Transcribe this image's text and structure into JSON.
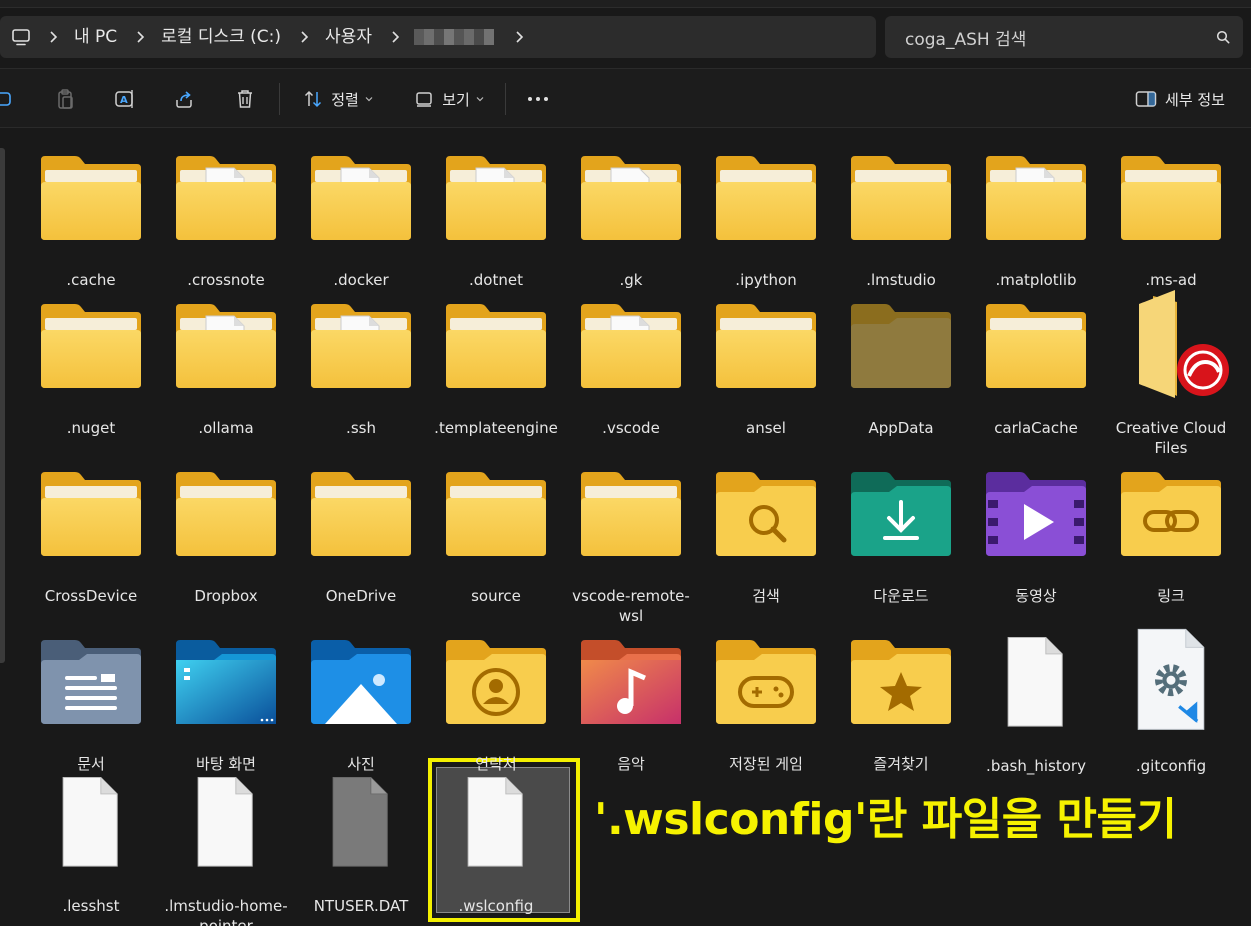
{
  "breadcrumb": {
    "items": [
      {
        "label": "내 PC"
      },
      {
        "label": "로컬 디스크 (C:)"
      },
      {
        "label": "사용자"
      }
    ]
  },
  "search": {
    "placeholder": "coga_ASH 검색"
  },
  "toolbar": {
    "sort_label": "정렬",
    "view_label": "보기",
    "details_label": "세부 정보"
  },
  "items": [
    {
      "name": ".cache",
      "icon": "folder-icon"
    },
    {
      "name": ".crossnote",
      "icon": "folder-with-file-icon"
    },
    {
      "name": ".docker",
      "icon": "folder-with-file-icon"
    },
    {
      "name": ".dotnet",
      "icon": "folder-with-file-icon"
    },
    {
      "name": ".gk",
      "icon": "folder-with-json-icon"
    },
    {
      "name": ".ipython",
      "icon": "folder-icon"
    },
    {
      "name": ".lmstudio",
      "icon": "folder-icon"
    },
    {
      "name": ".matplotlib",
      "icon": "folder-with-file-icon"
    },
    {
      "name": ".ms-ad",
      "icon": "folder-icon"
    },
    {
      "name": ".nuget",
      "icon": "folder-icon"
    },
    {
      "name": ".ollama",
      "icon": "folder-with-file-icon"
    },
    {
      "name": ".ssh",
      "icon": "folder-with-file-icon"
    },
    {
      "name": ".templateengine",
      "icon": "folder-icon"
    },
    {
      "name": ".vscode",
      "icon": "folder-with-file-icon"
    },
    {
      "name": "ansel",
      "icon": "folder-icon"
    },
    {
      "name": "AppData",
      "icon": "hidden-folder-icon"
    },
    {
      "name": "carlaCache",
      "icon": "folder-icon"
    },
    {
      "name": "Creative Cloud Files",
      "icon": "creative-cloud-folder-icon"
    },
    {
      "name": "CrossDevice",
      "icon": "folder-icon"
    },
    {
      "name": "Dropbox",
      "icon": "folder-icon"
    },
    {
      "name": "OneDrive",
      "icon": "folder-icon"
    },
    {
      "name": "source",
      "icon": "folder-icon"
    },
    {
      "name": "vscode-remote-wsl",
      "icon": "folder-icon"
    },
    {
      "name": "검색",
      "icon": "search-folder-icon"
    },
    {
      "name": "다운로드",
      "icon": "downloads-folder-icon"
    },
    {
      "name": "동영상",
      "icon": "videos-folder-icon"
    },
    {
      "name": "링크",
      "icon": "links-folder-icon"
    },
    {
      "name": "문서",
      "icon": "documents-folder-icon"
    },
    {
      "name": "바탕 화면",
      "icon": "desktop-folder-icon"
    },
    {
      "name": "사진",
      "icon": "pictures-folder-icon"
    },
    {
      "name": "연락처",
      "icon": "contacts-folder-icon"
    },
    {
      "name": "음악",
      "icon": "music-folder-icon"
    },
    {
      "name": "저장된 게임",
      "icon": "saved-games-folder-icon"
    },
    {
      "name": "즐겨찾기",
      "icon": "favorites-folder-icon"
    },
    {
      "name": ".bash_history",
      "icon": "file-icon"
    },
    {
      "name": ".gitconfig",
      "icon": "vscode-config-file-icon"
    },
    {
      "name": ".lesshst",
      "icon": "file-icon"
    },
    {
      "name": ".lmstudio-home-pointer",
      "icon": "file-icon"
    },
    {
      "name": "NTUSER.DAT",
      "icon": "hidden-file-icon"
    },
    {
      "name": ".wslconfig",
      "icon": "file-icon"
    }
  ],
  "annotation": {
    "text": "'.wslconfig'란 파일을 만들기",
    "color": "#f6f200"
  },
  "colors": {
    "folder_front": "#f8cf4f",
    "folder_back": "#e6a91c",
    "background": "#191919",
    "highlight": "#f4f000"
  }
}
